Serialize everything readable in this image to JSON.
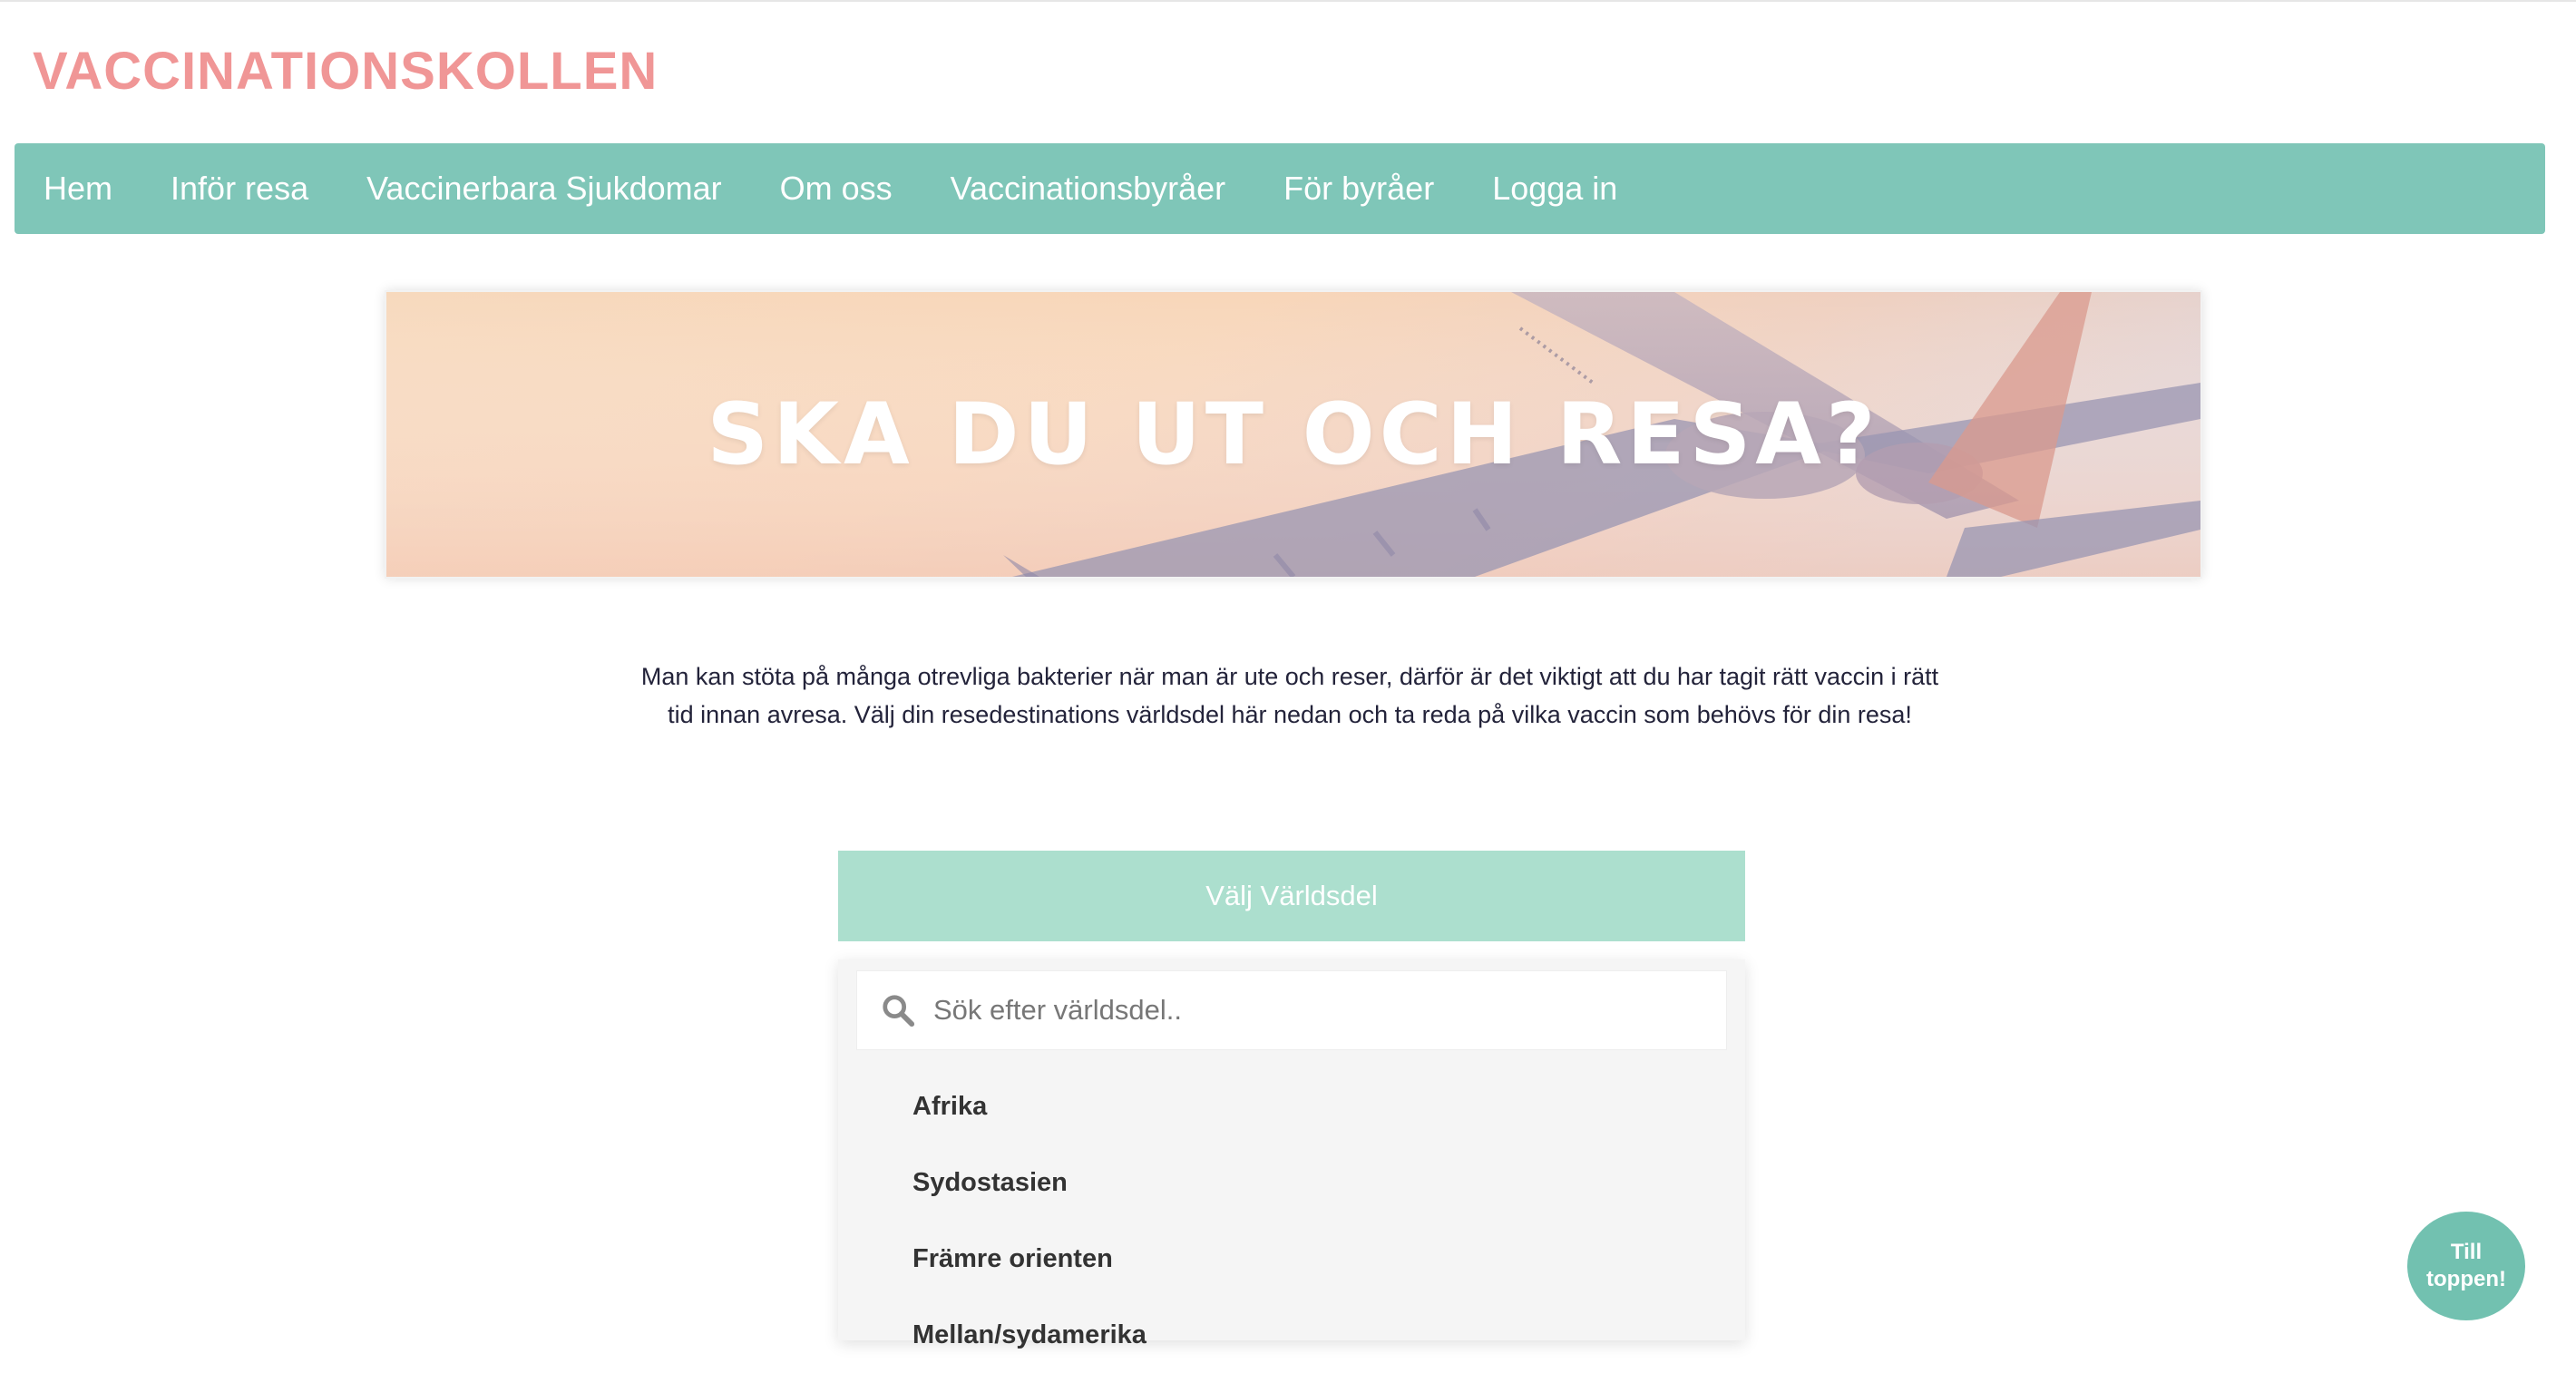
{
  "brand": {
    "title": "VACCINATIONSKOLLEN",
    "color": "#f09696"
  },
  "nav": {
    "color": "#7fc6b8",
    "items": [
      {
        "label": "Hem"
      },
      {
        "label": "Inför resa"
      },
      {
        "label": "Vaccinerbara Sjukdomar"
      },
      {
        "label": "Om oss"
      },
      {
        "label": "Vaccinationsbyråer"
      },
      {
        "label": "För byråer"
      },
      {
        "label": "Logga in"
      }
    ]
  },
  "hero": {
    "title": "SKA DU UT OCH RESA?",
    "image": "airplane-sunset"
  },
  "intro": {
    "text": "Man kan stöta på många otrevliga bakterier när man är ute och reser, därför är det viktigt att du har tagit rätt vaccin i rätt tid innan avresa. Välj din resedestinations världsdel här nedan och ta reda på vilka vaccin som behövs för din resa!"
  },
  "region_select": {
    "button_label": "Välj Världsdel",
    "button_color": "#acdfce",
    "search_placeholder": "Sök efter världsdel..",
    "search_icon": "search-icon",
    "options": [
      {
        "label": "Afrika"
      },
      {
        "label": "Sydostasien"
      },
      {
        "label": "Främre orienten"
      },
      {
        "label": "Mellan/sydamerika"
      }
    ]
  },
  "to_top": {
    "label": "Till toppen!",
    "color": "#72c1b0"
  }
}
